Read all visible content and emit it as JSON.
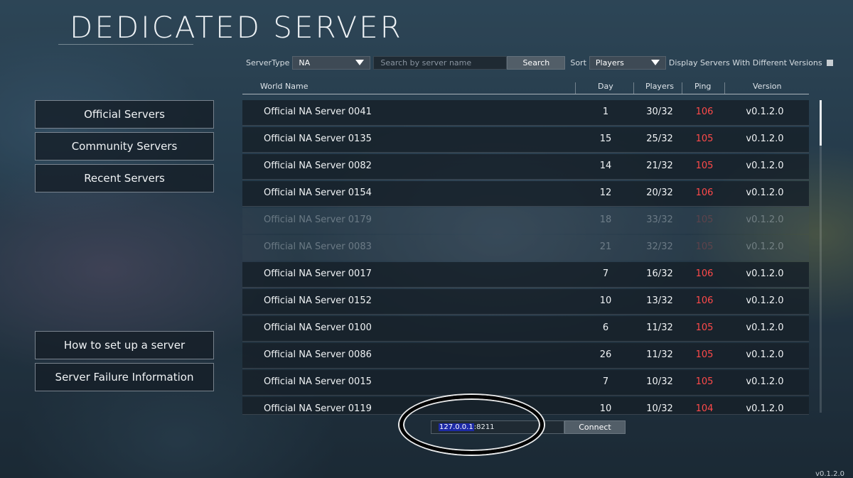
{
  "title": "DEDICATED SERVER",
  "filters": {
    "server_type_label": "ServerType",
    "server_type_value": "NA",
    "search_placeholder": "Search by server name",
    "search_button": "Search",
    "sort_label": "Sort",
    "sort_value": "Players",
    "different_versions_label": "Display Servers With Different Versions"
  },
  "table": {
    "headers": {
      "world_name": "World Name",
      "day": "Day",
      "players": "Players",
      "ping": "Ping",
      "version": "Version"
    },
    "rows": [
      {
        "name": "Official NA Server 0041",
        "day": "1",
        "players": "30/32",
        "ping": "106",
        "version": "v0.1.2.0",
        "dim": false
      },
      {
        "name": "Official NA Server 0135",
        "day": "15",
        "players": "25/32",
        "ping": "105",
        "version": "v0.1.2.0",
        "dim": false
      },
      {
        "name": "Official NA Server 0082",
        "day": "14",
        "players": "21/32",
        "ping": "105",
        "version": "v0.1.2.0",
        "dim": false
      },
      {
        "name": "Official NA Server 0154",
        "day": "12",
        "players": "20/32",
        "ping": "106",
        "version": "v0.1.2.0",
        "dim": false
      },
      {
        "name": "Official NA Server 0179",
        "day": "18",
        "players": "33/32",
        "ping": "105",
        "version": "v0.1.2.0",
        "dim": true
      },
      {
        "name": "Official NA Server 0083",
        "day": "21",
        "players": "32/32",
        "ping": "105",
        "version": "v0.1.2.0",
        "dim": true
      },
      {
        "name": "Official NA Server 0017",
        "day": "7",
        "players": "16/32",
        "ping": "106",
        "version": "v0.1.2.0",
        "dim": false
      },
      {
        "name": "Official NA Server 0152",
        "day": "10",
        "players": "13/32",
        "ping": "106",
        "version": "v0.1.2.0",
        "dim": false
      },
      {
        "name": "Official NA Server 0100",
        "day": "6",
        "players": "11/32",
        "ping": "105",
        "version": "v0.1.2.0",
        "dim": false
      },
      {
        "name": "Official NA Server 0086",
        "day": "26",
        "players": "11/32",
        "ping": "105",
        "version": "v0.1.2.0",
        "dim": false
      },
      {
        "name": "Official NA Server 0015",
        "day": "7",
        "players": "10/32",
        "ping": "105",
        "version": "v0.1.2.0",
        "dim": false
      },
      {
        "name": "Official NA Server 0119",
        "day": "10",
        "players": "10/32",
        "ping": "104",
        "version": "v0.1.2.0",
        "dim": false
      }
    ]
  },
  "sidebar": {
    "official": "Official Servers",
    "community": "Community Servers",
    "recent": "Recent Servers",
    "how_to": "How to set up a server",
    "failure_info": "Server Failure Information"
  },
  "connect": {
    "ip_selected": "127.0.0.1",
    "ip_port": ":8211",
    "button": "Connect"
  },
  "version_corner": "v0.1.2.0",
  "colors": {
    "ping": "#ff4a4a",
    "ip_highlight": "#1d2aa6"
  }
}
